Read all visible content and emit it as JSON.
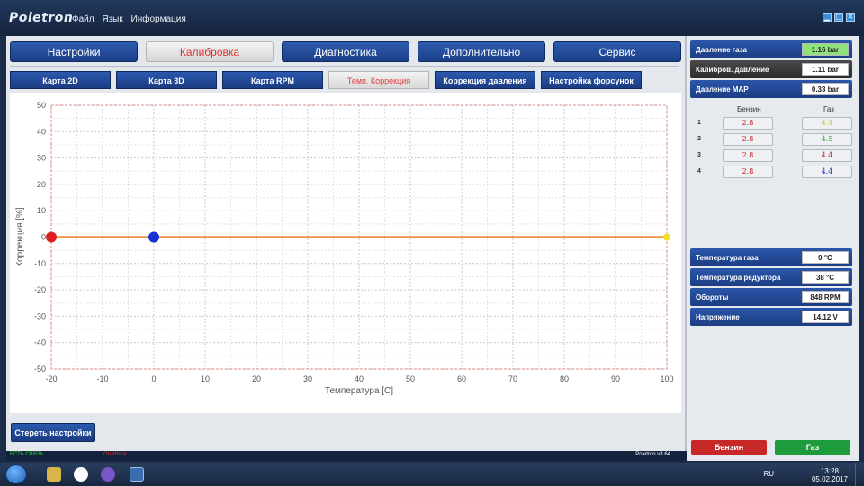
{
  "window": {
    "logo": "Poletron",
    "menu": [
      "Файл",
      "Язык",
      "Информация"
    ],
    "controls": {
      "minimize": "▁",
      "maximize": "▢",
      "close": "✕"
    }
  },
  "main_tabs": [
    {
      "label": "Настройки",
      "active": false
    },
    {
      "label": "Калибровка",
      "active": true
    },
    {
      "label": "Диагностика",
      "active": false
    },
    {
      "label": "Дополнительно",
      "active": false
    },
    {
      "label": "Сервис",
      "active": false
    }
  ],
  "sub_tabs": [
    {
      "label": "Карта 2D",
      "active": false
    },
    {
      "label": "Карта 3D",
      "active": false
    },
    {
      "label": "Карта RPM",
      "active": false
    },
    {
      "label": "Темп. Коррекция",
      "active": true
    },
    {
      "label": "Коррекция давления",
      "active": false
    },
    {
      "label": "Настройка форсунок",
      "active": false
    }
  ],
  "chart_data": {
    "type": "line",
    "xlabel": "Температура [C]",
    "ylabel": "Коррекция [%]",
    "xlim": [
      -20,
      100
    ],
    "ylim": [
      -50,
      50
    ],
    "x_ticks": [
      -20,
      -10,
      0,
      10,
      20,
      30,
      40,
      50,
      60,
      70,
      80,
      90,
      100
    ],
    "y_ticks": [
      50,
      40,
      30,
      20,
      10,
      0,
      -10,
      -20,
      -30,
      -40,
      -50
    ],
    "grid": true,
    "series": [
      {
        "color": "#e05a1a",
        "x": [
          -20,
          100
        ],
        "y": [
          0,
          0
        ]
      }
    ],
    "markers": [
      {
        "x": -20,
        "y": 0,
        "color": "#e02020",
        "size": "large"
      },
      {
        "x": 0,
        "y": 0,
        "color": "#1a2fd0",
        "size": "large"
      },
      {
        "x": 100,
        "y": 0,
        "color": "#f0e020",
        "size": "small"
      }
    ]
  },
  "erase_button": "Стереть настройки",
  "status": {
    "left": "ЕСТЬ СВЯЗЬ",
    "middle": "ОШИБКА",
    "version": "Poletron v3.64"
  },
  "sensors_top": [
    {
      "label": "Давление газа",
      "value": "1.16 bar",
      "highlight": "green",
      "dark": false
    },
    {
      "label": "Калибров. давление",
      "value": "1.11 bar",
      "highlight": "",
      "dark": true
    },
    {
      "label": "Давление MAP",
      "value": "0.33 bar",
      "highlight": "",
      "dark": false
    }
  ],
  "injectors": {
    "headers": {
      "petrol": "Бензин",
      "gas": "Газ"
    },
    "rows": [
      {
        "num": "1",
        "petrol": "2.8",
        "gas": "4.4",
        "gas_color": "#d8c820"
      },
      {
        "num": "2",
        "petrol": "2.8",
        "gas": "4.5",
        "gas_color": "#2ea82e"
      },
      {
        "num": "3",
        "petrol": "2.8",
        "gas": "4.4",
        "gas_color": "#c02020"
      },
      {
        "num": "4",
        "petrol": "2.8",
        "gas": "4.4",
        "gas_color": "#1a2fd0"
      }
    ],
    "petrol_color": "#c02020"
  },
  "sensors_bottom": [
    {
      "label": "Температура газа",
      "value": "0 °C"
    },
    {
      "label": "Температура редуктора",
      "value": "38 °C"
    },
    {
      "label": "Обороты",
      "value": "848 RPM"
    },
    {
      "label": "Напряжение",
      "value": "14.12 V"
    }
  ],
  "fuel_buttons": [
    {
      "label": "Бензин",
      "color": "#c62828"
    },
    {
      "label": "Газ",
      "color": "#1e9c3c"
    }
  ],
  "taskbar": {
    "lang": "RU",
    "time": "13:28",
    "date": "05.02.2017",
    "icons": [
      "folder-icon",
      "yandex-browser-icon",
      "viber-icon",
      "poletron-app-icon"
    ]
  }
}
